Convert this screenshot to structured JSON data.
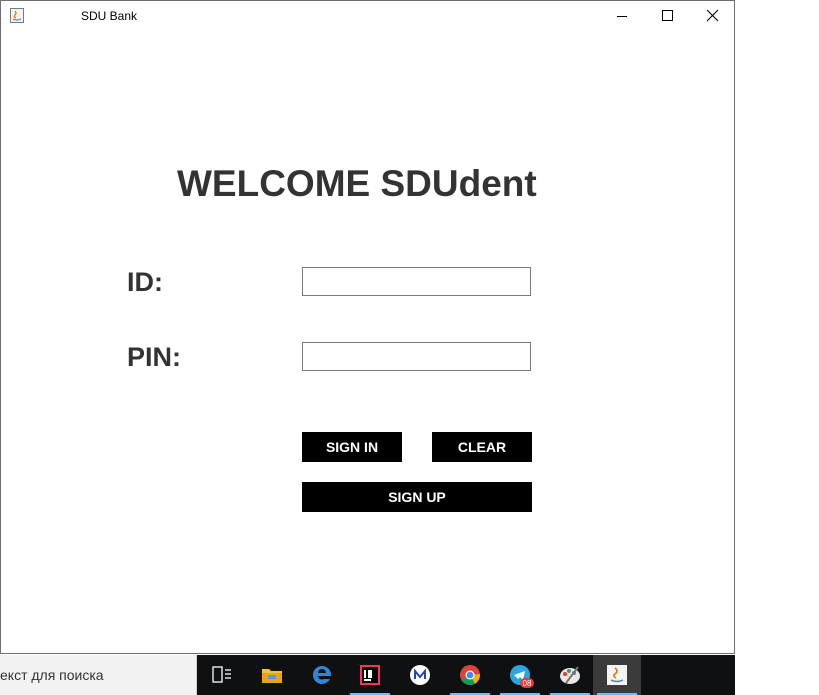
{
  "window": {
    "title": "SDU Bank",
    "controls": [
      "minimize",
      "maximize",
      "close"
    ]
  },
  "main": {
    "welcome": "WELCOME SDUdent",
    "id_label": "ID:",
    "pin_label": "PIN:",
    "id_value": "",
    "pin_value": "",
    "sign_in_label": "SIGN IN",
    "clear_label": "CLEAR",
    "sign_up_label": "SIGN UP"
  },
  "taskbar": {
    "search_placeholder": "екст для поиска",
    "apps": [
      {
        "name": "task-view-icon"
      },
      {
        "name": "file-explorer-icon"
      },
      {
        "name": "edge-icon"
      },
      {
        "name": "intellij-icon"
      },
      {
        "name": "app-circle-icon"
      },
      {
        "name": "chrome-icon"
      },
      {
        "name": "telegram-icon",
        "badge": "08"
      },
      {
        "name": "paint-icon"
      },
      {
        "name": "java-icon"
      }
    ]
  },
  "colors": {
    "button_bg": "#000000",
    "button_text": "#ffffff",
    "heading_text": "#333333",
    "taskbar_bg": "#0f1012",
    "taskbar_active": "#3b3b3b",
    "taskbar_underline": "#76b9ed"
  }
}
